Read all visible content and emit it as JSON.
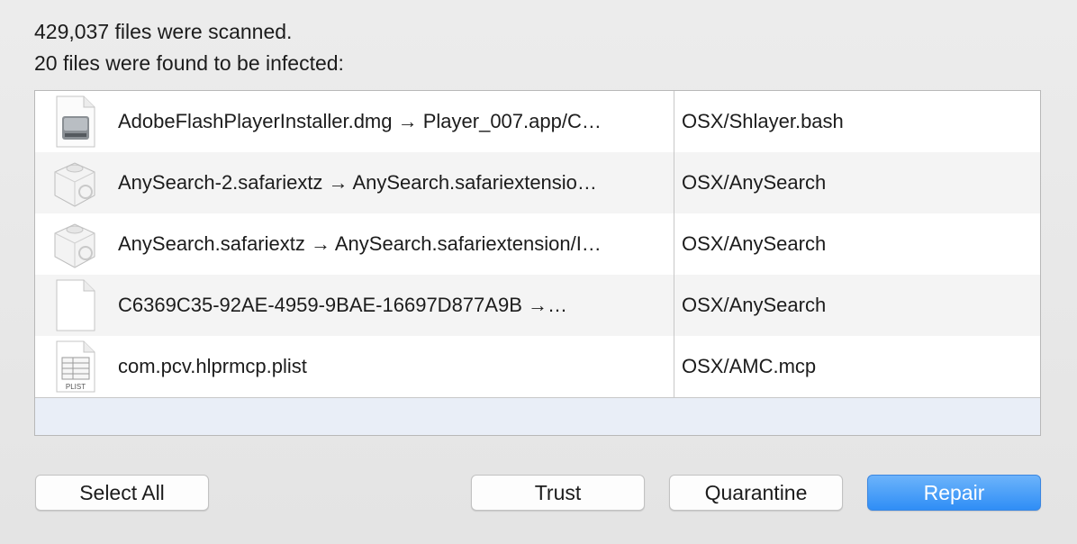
{
  "summary": {
    "scanned": "429,037 files were scanned.",
    "infected": "20 files were found to be infected:"
  },
  "results": [
    {
      "file": "AdobeFlashPlayerInstaller.dmg → Player_007.app/C…",
      "threat": "OSX/Shlayer.bash",
      "icon": "disk-image-icon"
    },
    {
      "file": "AnySearch-2.safariextz → AnySearch.safariextensio…",
      "threat": "OSX/AnySearch",
      "icon": "safari-extension-icon"
    },
    {
      "file": "AnySearch.safariextz → AnySearch.safariextension/I…",
      "threat": "OSX/AnySearch",
      "icon": "safari-extension-icon"
    },
    {
      "file": "C6369C35-92AE-4959-9BAE-16697D877A9B →…",
      "threat": "OSX/AnySearch",
      "icon": "blank-document-icon"
    },
    {
      "file": "com.pcv.hlprmcp.plist",
      "threat": "OSX/AMC.mcp",
      "icon": "plist-file-icon",
      "icon_label": "PLIST"
    }
  ],
  "buttons": {
    "select_all": "Select All",
    "trust": "Trust",
    "quarantine": "Quarantine",
    "repair": "Repair"
  },
  "colors": {
    "primary_button": "#2f8ef6",
    "selection_area": "#e9eef7"
  }
}
